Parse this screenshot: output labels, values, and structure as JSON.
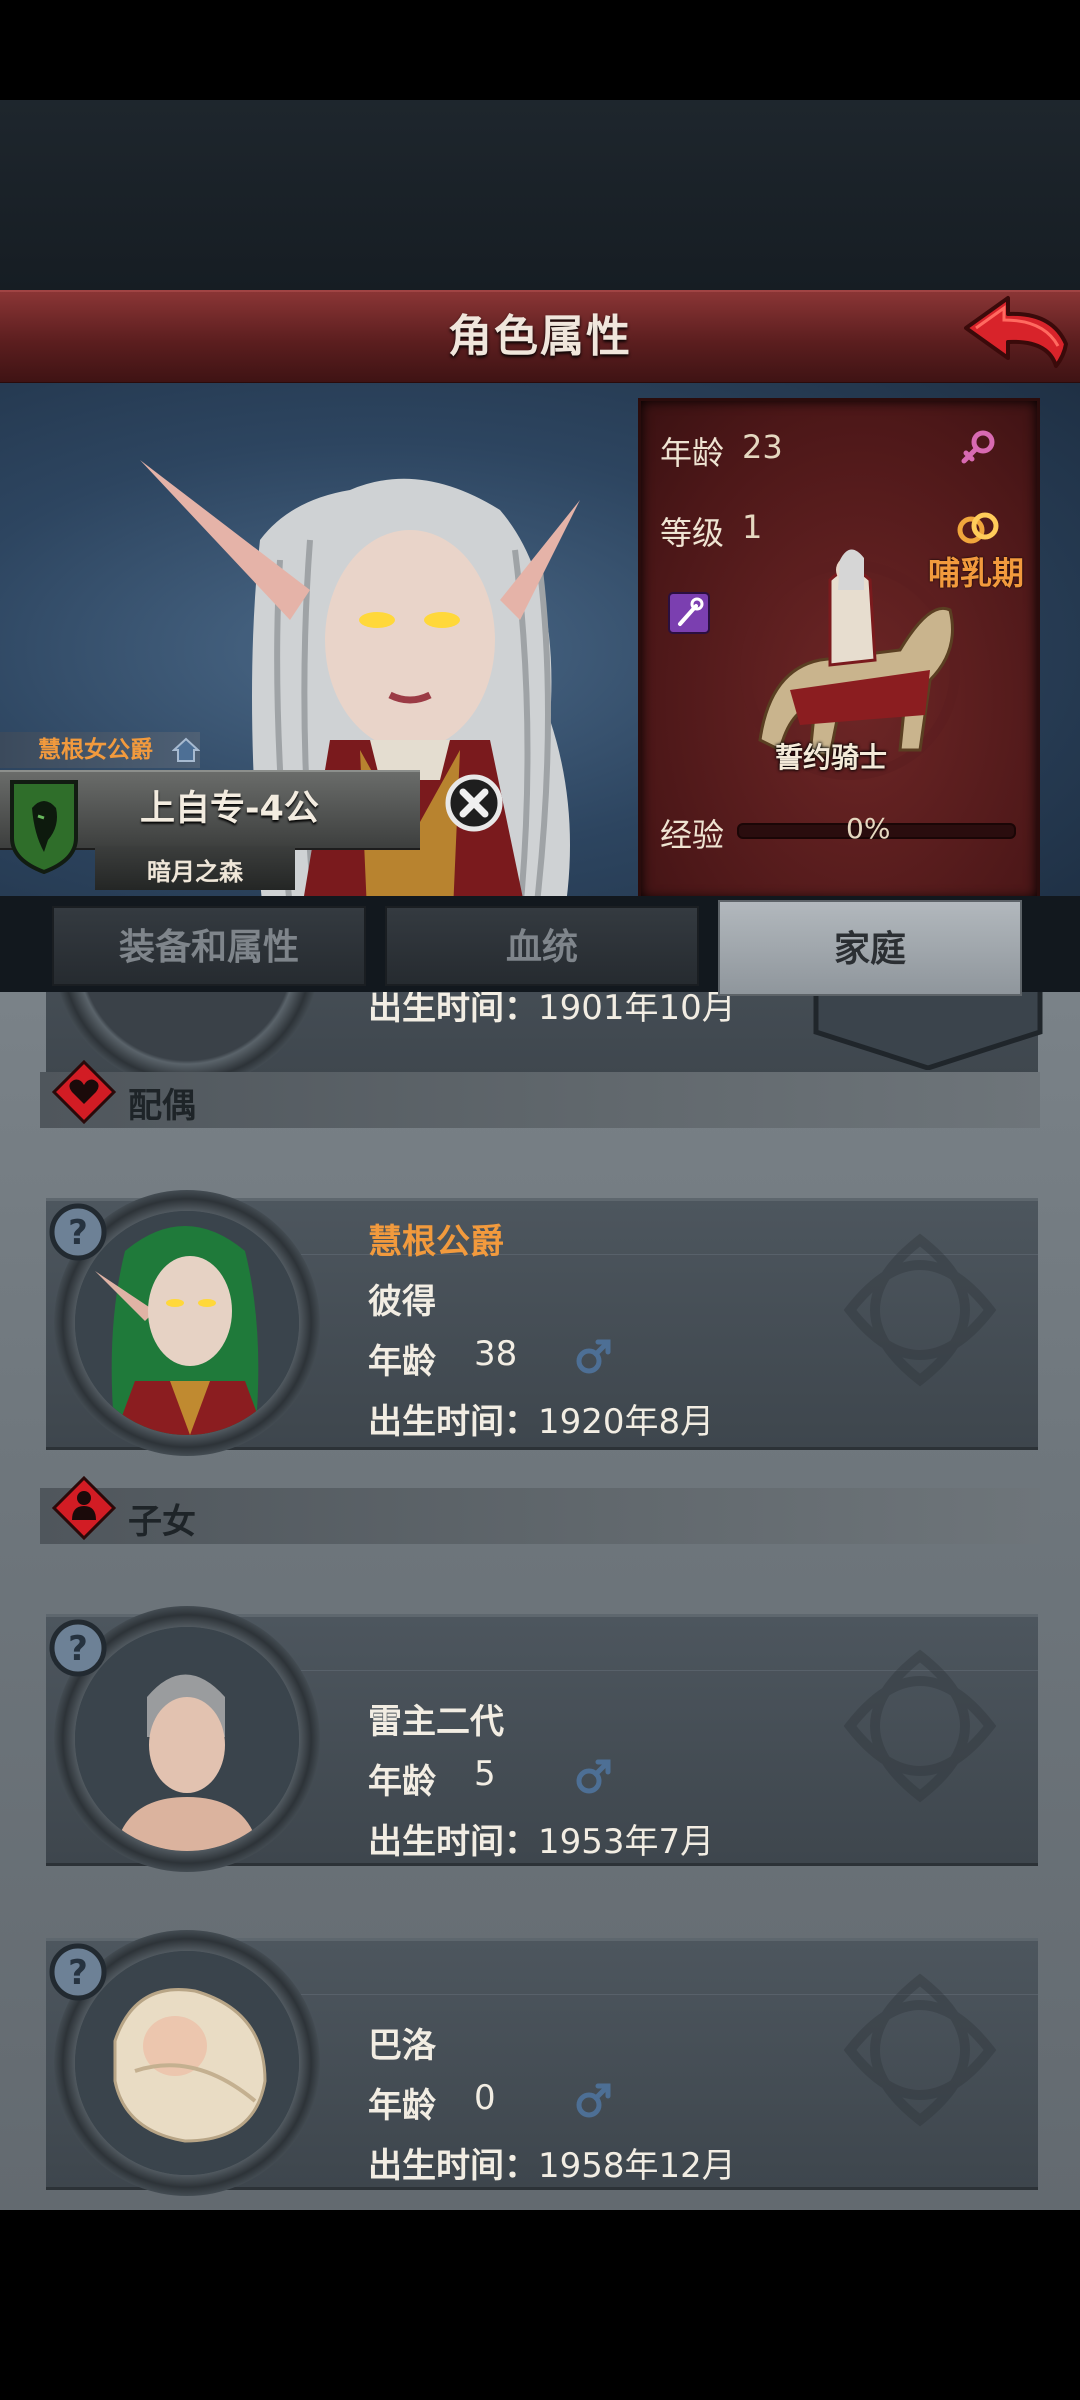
{
  "header": {
    "title": "角色属性"
  },
  "character": {
    "noble_title": "慧根女公爵",
    "name": "上自专-4公",
    "region": "暗月之森",
    "stats": {
      "age_label": "年龄",
      "age_value": "23",
      "level_label": "等级",
      "level_value": "1",
      "status": "哺乳期",
      "class_name": "誓约骑士",
      "exp_label": "经验",
      "exp_value": "0%",
      "exp_progress": 0
    }
  },
  "tabs": [
    {
      "label": "装备和属性",
      "active": false
    },
    {
      "label": "血统",
      "active": false
    },
    {
      "label": "家庭",
      "active": true
    }
  ],
  "family": {
    "partial_parent": {
      "birth_label": "出生时间：",
      "birth_value": "1901年10月"
    },
    "spouse_section": "配偶",
    "spouse": {
      "noble_title": "慧根公爵",
      "name": "彼得",
      "age_label": "年龄",
      "age": "38",
      "birth_label": "出生时间：",
      "birth": "1920年8月"
    },
    "children_section": "子女",
    "children": [
      {
        "name": "雷主二代",
        "age_label": "年龄",
        "age": "5",
        "birth_label": "出生时间：",
        "birth": "1953年7月"
      },
      {
        "name": "巴洛",
        "age_label": "年龄",
        "age": "0",
        "birth_label": "出生时间：",
        "birth": "1958年12月"
      }
    ]
  },
  "colors": {
    "title_red": "#6e2526",
    "accent_orange": "#f29a3d",
    "male_blue": "#4d6f95",
    "female_pink": "#d86ab1"
  }
}
